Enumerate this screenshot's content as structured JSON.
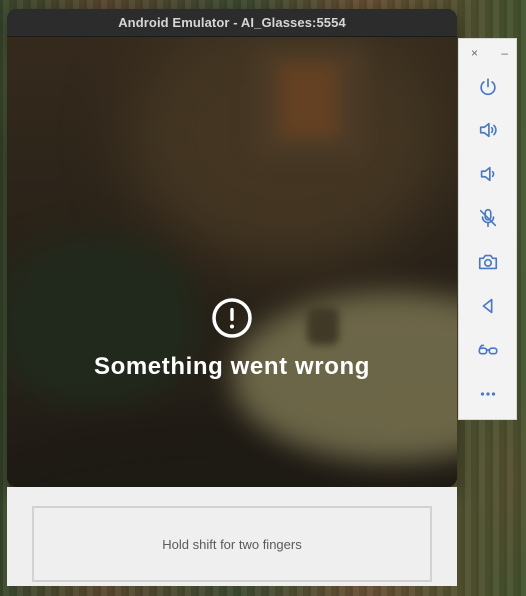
{
  "window": {
    "title": "Android Emulator - AI_Glasses:5554"
  },
  "screen": {
    "error_message": "Something went wrong"
  },
  "toolbar": {
    "close_label": "×",
    "minimize_label": "–",
    "buttons": [
      {
        "icon": "power-icon"
      },
      {
        "icon": "volume-up-icon"
      },
      {
        "icon": "volume-down-icon"
      },
      {
        "icon": "mic-off-icon"
      },
      {
        "icon": "camera-icon"
      },
      {
        "icon": "back-icon"
      },
      {
        "icon": "glasses-icon"
      },
      {
        "icon": "more-icon"
      }
    ]
  },
  "touch_panel": {
    "hint": "Hold shift for two fingers"
  },
  "colors": {
    "toolbar_icon": "#4a78c2",
    "titlebar": "#2c2c2c",
    "panel_bg": "#efefef"
  }
}
